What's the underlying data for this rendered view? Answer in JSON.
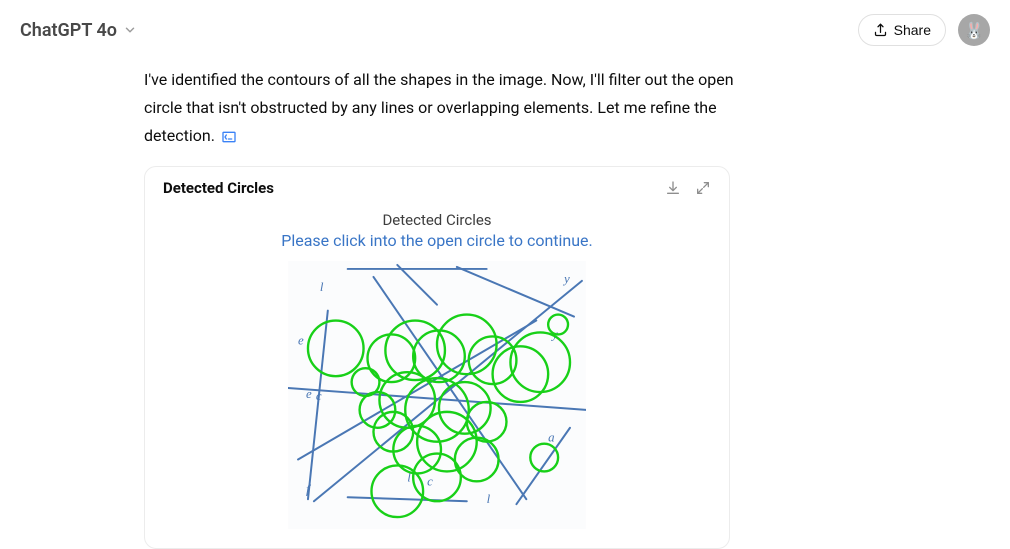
{
  "header": {
    "model_label": "ChatGPT 4o",
    "share_label": "Share",
    "avatar_glyph": "🐰"
  },
  "message": {
    "text": "I've identified the contours of all the shapes in the image. Now, I'll filter out the open circle that isn't obstructed by any lines or overlapping elements. Let me refine the detection."
  },
  "card": {
    "title": "Detected Circles",
    "figure_title": "Detected Circles",
    "figure_subtitle": "Please click into the open circle to continue."
  },
  "chart_data": {
    "type": "scatter",
    "title": "Detected Circles",
    "subtitle": "Please click into the open circle to continue.",
    "xlim": [
      0,
      300
    ],
    "ylim": [
      0,
      270
    ],
    "circles": [
      {
        "cx": 48,
        "cy": 88,
        "r": 28
      },
      {
        "cx": 78,
        "cy": 122,
        "r": 14
      },
      {
        "cx": 104,
        "cy": 98,
        "r": 24
      },
      {
        "cx": 128,
        "cy": 90,
        "r": 30
      },
      {
        "cx": 152,
        "cy": 96,
        "r": 26
      },
      {
        "cx": 180,
        "cy": 84,
        "r": 30
      },
      {
        "cx": 206,
        "cy": 100,
        "r": 24
      },
      {
        "cx": 234,
        "cy": 114,
        "r": 28
      },
      {
        "cx": 254,
        "cy": 102,
        "r": 30
      },
      {
        "cx": 120,
        "cy": 140,
        "r": 28
      },
      {
        "cx": 150,
        "cy": 150,
        "r": 32
      },
      {
        "cx": 178,
        "cy": 148,
        "r": 26
      },
      {
        "cx": 200,
        "cy": 162,
        "r": 20
      },
      {
        "cx": 160,
        "cy": 182,
        "r": 30
      },
      {
        "cx": 130,
        "cy": 190,
        "r": 24
      },
      {
        "cx": 106,
        "cy": 172,
        "r": 20
      },
      {
        "cx": 90,
        "cy": 150,
        "r": 18
      },
      {
        "cx": 190,
        "cy": 200,
        "r": 22
      },
      {
        "cx": 150,
        "cy": 218,
        "r": 24
      },
      {
        "cx": 110,
        "cy": 232,
        "r": 26
      },
      {
        "cx": 258,
        "cy": 198,
        "r": 14
      },
      {
        "cx": 272,
        "cy": 64,
        "r": 10
      }
    ],
    "lines": [
      {
        "x1": 0,
        "y1": 128,
        "x2": 300,
        "y2": 150
      },
      {
        "x1": 26,
        "y1": 242,
        "x2": 296,
        "y2": 20
      },
      {
        "x1": 86,
        "y1": 16,
        "x2": 240,
        "y2": 240
      },
      {
        "x1": 10,
        "y1": 200,
        "x2": 250,
        "y2": 60
      },
      {
        "x1": 60,
        "y1": 8,
        "x2": 200,
        "y2": 8
      },
      {
        "x1": 170,
        "y1": 6,
        "x2": 288,
        "y2": 56
      },
      {
        "x1": 110,
        "y1": 4,
        "x2": 150,
        "y2": 44
      },
      {
        "x1": 40,
        "y1": 50,
        "x2": 20,
        "y2": 240
      },
      {
        "x1": 60,
        "y1": 238,
        "x2": 180,
        "y2": 242
      },
      {
        "x1": 230,
        "y1": 245,
        "x2": 284,
        "y2": 168
      }
    ],
    "letters": [
      {
        "t": "l",
        "x": 32,
        "y": 30
      },
      {
        "t": "e",
        "x": 10,
        "y": 84
      },
      {
        "t": "e",
        "x": 18,
        "y": 138
      },
      {
        "t": "c",
        "x": 28,
        "y": 140
      },
      {
        "t": "f",
        "x": 18,
        "y": 234
      },
      {
        "t": "l",
        "x": 120,
        "y": 222
      },
      {
        "t": "c",
        "x": 140,
        "y": 226
      },
      {
        "t": "a",
        "x": 262,
        "y": 182
      },
      {
        "t": "l",
        "x": 200,
        "y": 244
      },
      {
        "t": "y",
        "x": 278,
        "y": 22
      },
      {
        "t": "y",
        "x": 266,
        "y": 78
      }
    ]
  }
}
